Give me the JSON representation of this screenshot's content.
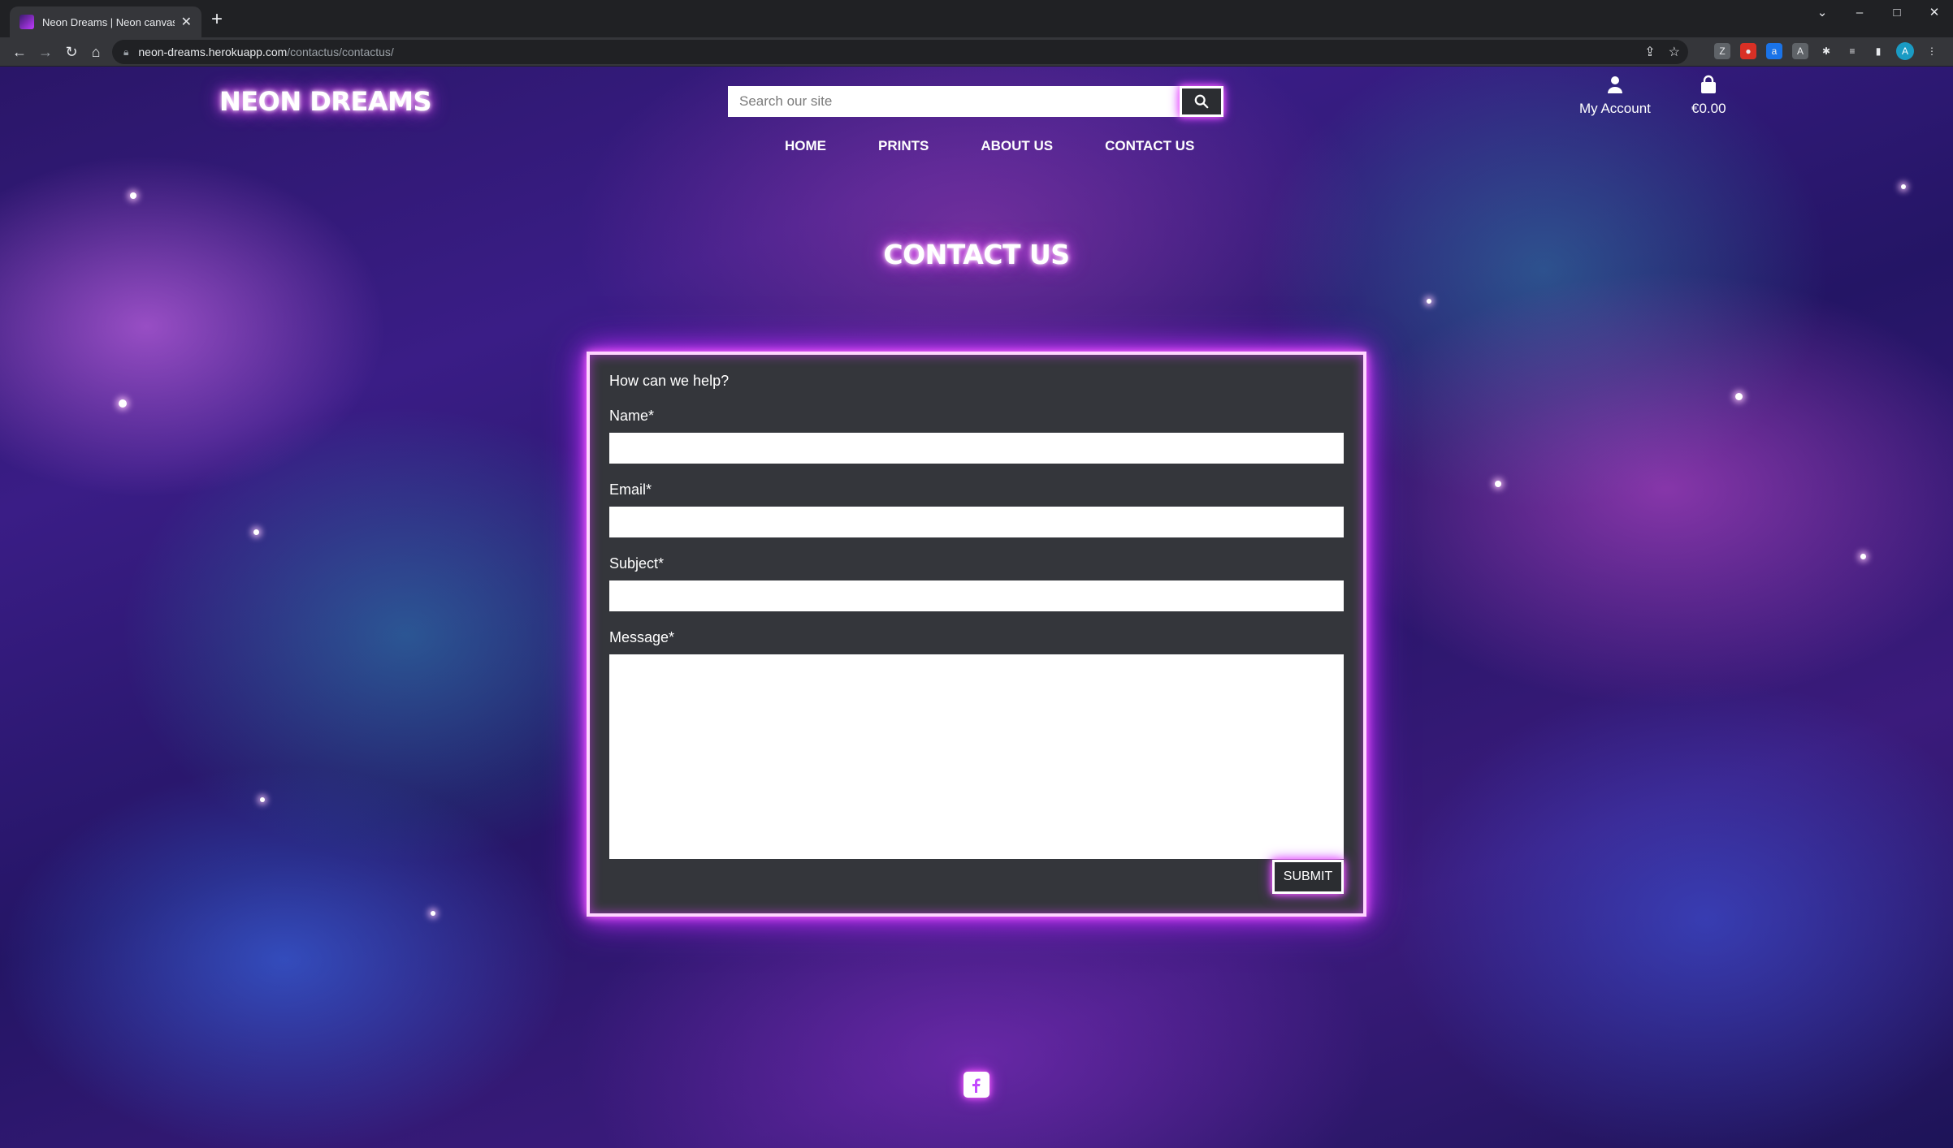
{
  "browser": {
    "tab_title": "Neon Dreams | Neon canvas prin",
    "url_host": "neon-dreams.herokuapp.com",
    "url_path": "/contactus/contactus/",
    "profile_initial": "A"
  },
  "site": {
    "logo": "NEON DREAMS",
    "search": {
      "placeholder": "Search our site"
    },
    "account_label": "My Account",
    "bag_total": "€0.00",
    "nav": [
      {
        "label": "HOME"
      },
      {
        "label": "PRINTS"
      },
      {
        "label": "ABOUT US"
      },
      {
        "label": "CONTACT US"
      }
    ]
  },
  "page": {
    "title": "CONTACT US",
    "form": {
      "intro": "How can we help?",
      "name_label": "Name*",
      "email_label": "Email*",
      "subject_label": "Subject*",
      "message_label": "Message*",
      "submit_label": "SUBMIT"
    }
  },
  "theme": {
    "neon_glow": "#d13cff",
    "card_bg": "#34363b",
    "icons": [
      "search-icon",
      "user-icon",
      "shopping-bag-icon",
      "facebook-icon"
    ]
  }
}
